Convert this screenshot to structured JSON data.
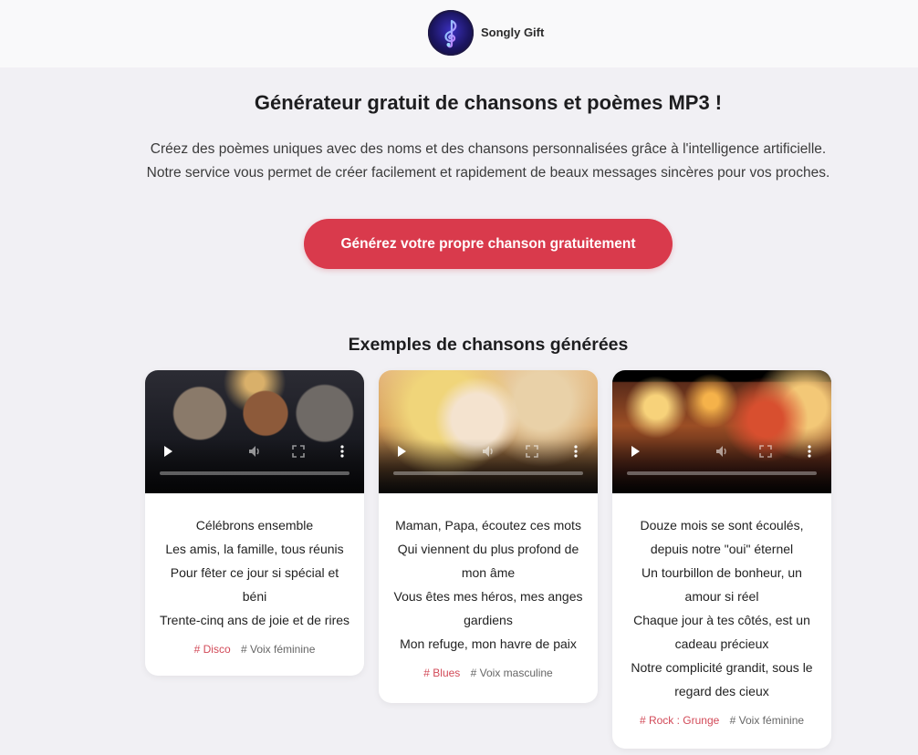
{
  "header": {
    "brand_name": "Songly Gift",
    "logo_icon": "music-note-icon"
  },
  "hero": {
    "title": "Générateur gratuit de chansons et poèmes MP3 !",
    "description_line1": "Créez des poèmes uniques avec des noms et des chansons personnalisées grâce à l'intelligence artificielle.",
    "description_line2": "Notre service vous permet de créer facilement et rapidement de beaux messages sincères pour vos proches.",
    "cta_label": "Générez votre propre chanson gratuitement"
  },
  "colors": {
    "accent": "#d93a4c",
    "background": "#f1f0f4",
    "tag_genre": "#d24a58"
  },
  "examples": {
    "title": "Exemples de chansons générées",
    "cards": [
      {
        "lyrics": [
          "Célébrons ensemble",
          "Les amis, la famille, tous réunis",
          "Pour fêter ce jour si spécial et béni",
          "Trente-cinq ans de joie et de rires"
        ],
        "genre_tag": "# Disco",
        "voice_tag": "# Voix féminine"
      },
      {
        "lyrics": [
          "Maman, Papa, écoutez ces mots",
          "Qui viennent du plus profond de mon âme",
          "Vous êtes mes héros, mes anges gardiens",
          "Mon refuge, mon havre de paix"
        ],
        "genre_tag": "# Blues",
        "voice_tag": "# Voix masculine"
      },
      {
        "lyrics": [
          "Douze mois se sont écoulés, depuis notre \"oui\" éternel",
          "Un tourbillon de bonheur, un amour si réel",
          "Chaque jour à tes côtés, est un cadeau précieux",
          "Notre complicité grandit, sous le regard des cieux"
        ],
        "genre_tag": "# Rock : Grunge",
        "voice_tag": "# Voix féminine"
      }
    ]
  },
  "video_controls": {
    "play_icon": "play-icon",
    "volume_icon": "volume-icon",
    "fullscreen_icon": "fullscreen-icon",
    "more_icon": "more-options-icon"
  }
}
